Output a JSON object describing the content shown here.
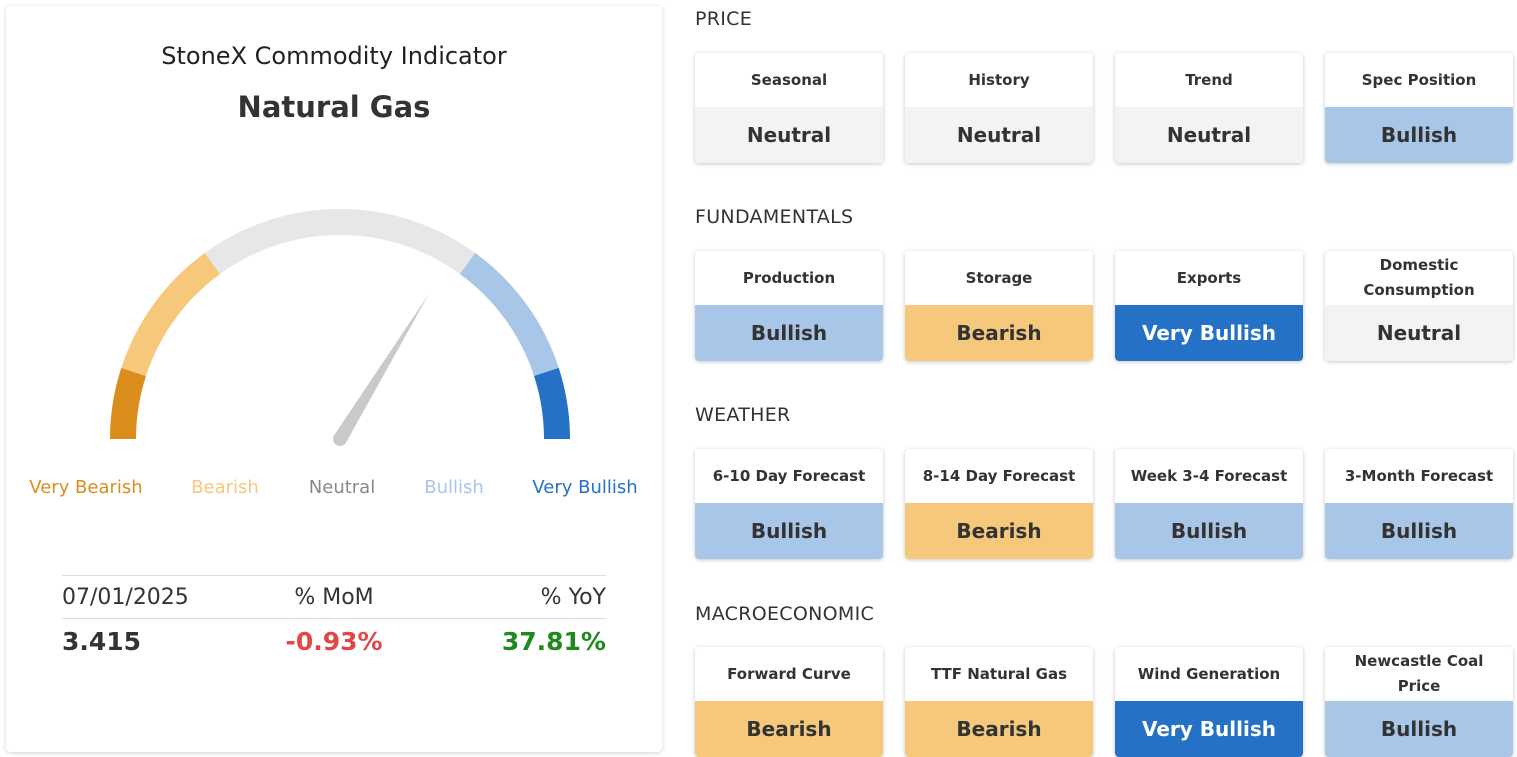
{
  "indicator": {
    "title": "StoneX Commodity Indicator",
    "commodity": "Natural Gas",
    "gauge": {
      "labels": [
        "Very Bearish",
        "Bearish",
        "Neutral",
        "Bullish",
        "Very Bullish"
      ],
      "colors": {
        "very_bearish": "#db8e1b",
        "bearish": "#f6c87b",
        "neutral": "#e6e7e6",
        "bullish": "#a8c6e8",
        "very_bullish": "#2571c6",
        "needle": "#c8cac9"
      },
      "label_colors": {
        "very_bearish": "#db8e1b",
        "bearish": "#f6c87b",
        "neutral": "#888888",
        "bullish": "#a8c6e8",
        "very_bullish": "#2571c6"
      },
      "needle_level": 0.675
    },
    "stats": {
      "headers": [
        "07/01/2025",
        "% MoM",
        "% YoY"
      ],
      "values": [
        "3.415",
        "-0.93%",
        "37.81%"
      ],
      "value_colors": [
        "#333333",
        "#e04848",
        "#1e8a1e"
      ]
    }
  },
  "status_colors": {
    "Very Bearish": "#db8e1b",
    "Bearish": "#f6c87b",
    "Neutral": "#f2f3f2",
    "Bullish": "#a8c6e8",
    "Very Bullish": "#2571c6"
  },
  "sections": [
    {
      "title": "PRICE",
      "tiles": [
        {
          "name": "Seasonal",
          "value": "Neutral"
        },
        {
          "name": "History",
          "value": "Neutral"
        },
        {
          "name": "Trend",
          "value": "Neutral"
        },
        {
          "name": "Spec Position",
          "value": "Bullish"
        }
      ]
    },
    {
      "title": "FUNDAMENTALS",
      "tiles": [
        {
          "name": "Production",
          "value": "Bullish"
        },
        {
          "name": "Storage",
          "value": "Bearish"
        },
        {
          "name": "Exports",
          "value": "Very Bullish"
        },
        {
          "name": "Domestic Consumption",
          "value": "Neutral"
        }
      ]
    },
    {
      "title": "WEATHER",
      "tiles": [
        {
          "name": "6-10 Day Forecast",
          "value": "Bullish"
        },
        {
          "name": "8-14 Day Forecast",
          "value": "Bearish"
        },
        {
          "name": "Week 3-4 Forecast",
          "value": "Bullish"
        },
        {
          "name": "3-Month Forecast",
          "value": "Bullish"
        }
      ]
    },
    {
      "title": "MACROECONOMIC",
      "tiles": [
        {
          "name": "Forward Curve",
          "value": "Bearish"
        },
        {
          "name": "TTF Natural Gas",
          "value": "Bearish"
        },
        {
          "name": "Wind Generation",
          "value": "Very Bullish"
        },
        {
          "name": "Newcastle Coal Price",
          "value": "Bullish"
        }
      ]
    }
  ]
}
